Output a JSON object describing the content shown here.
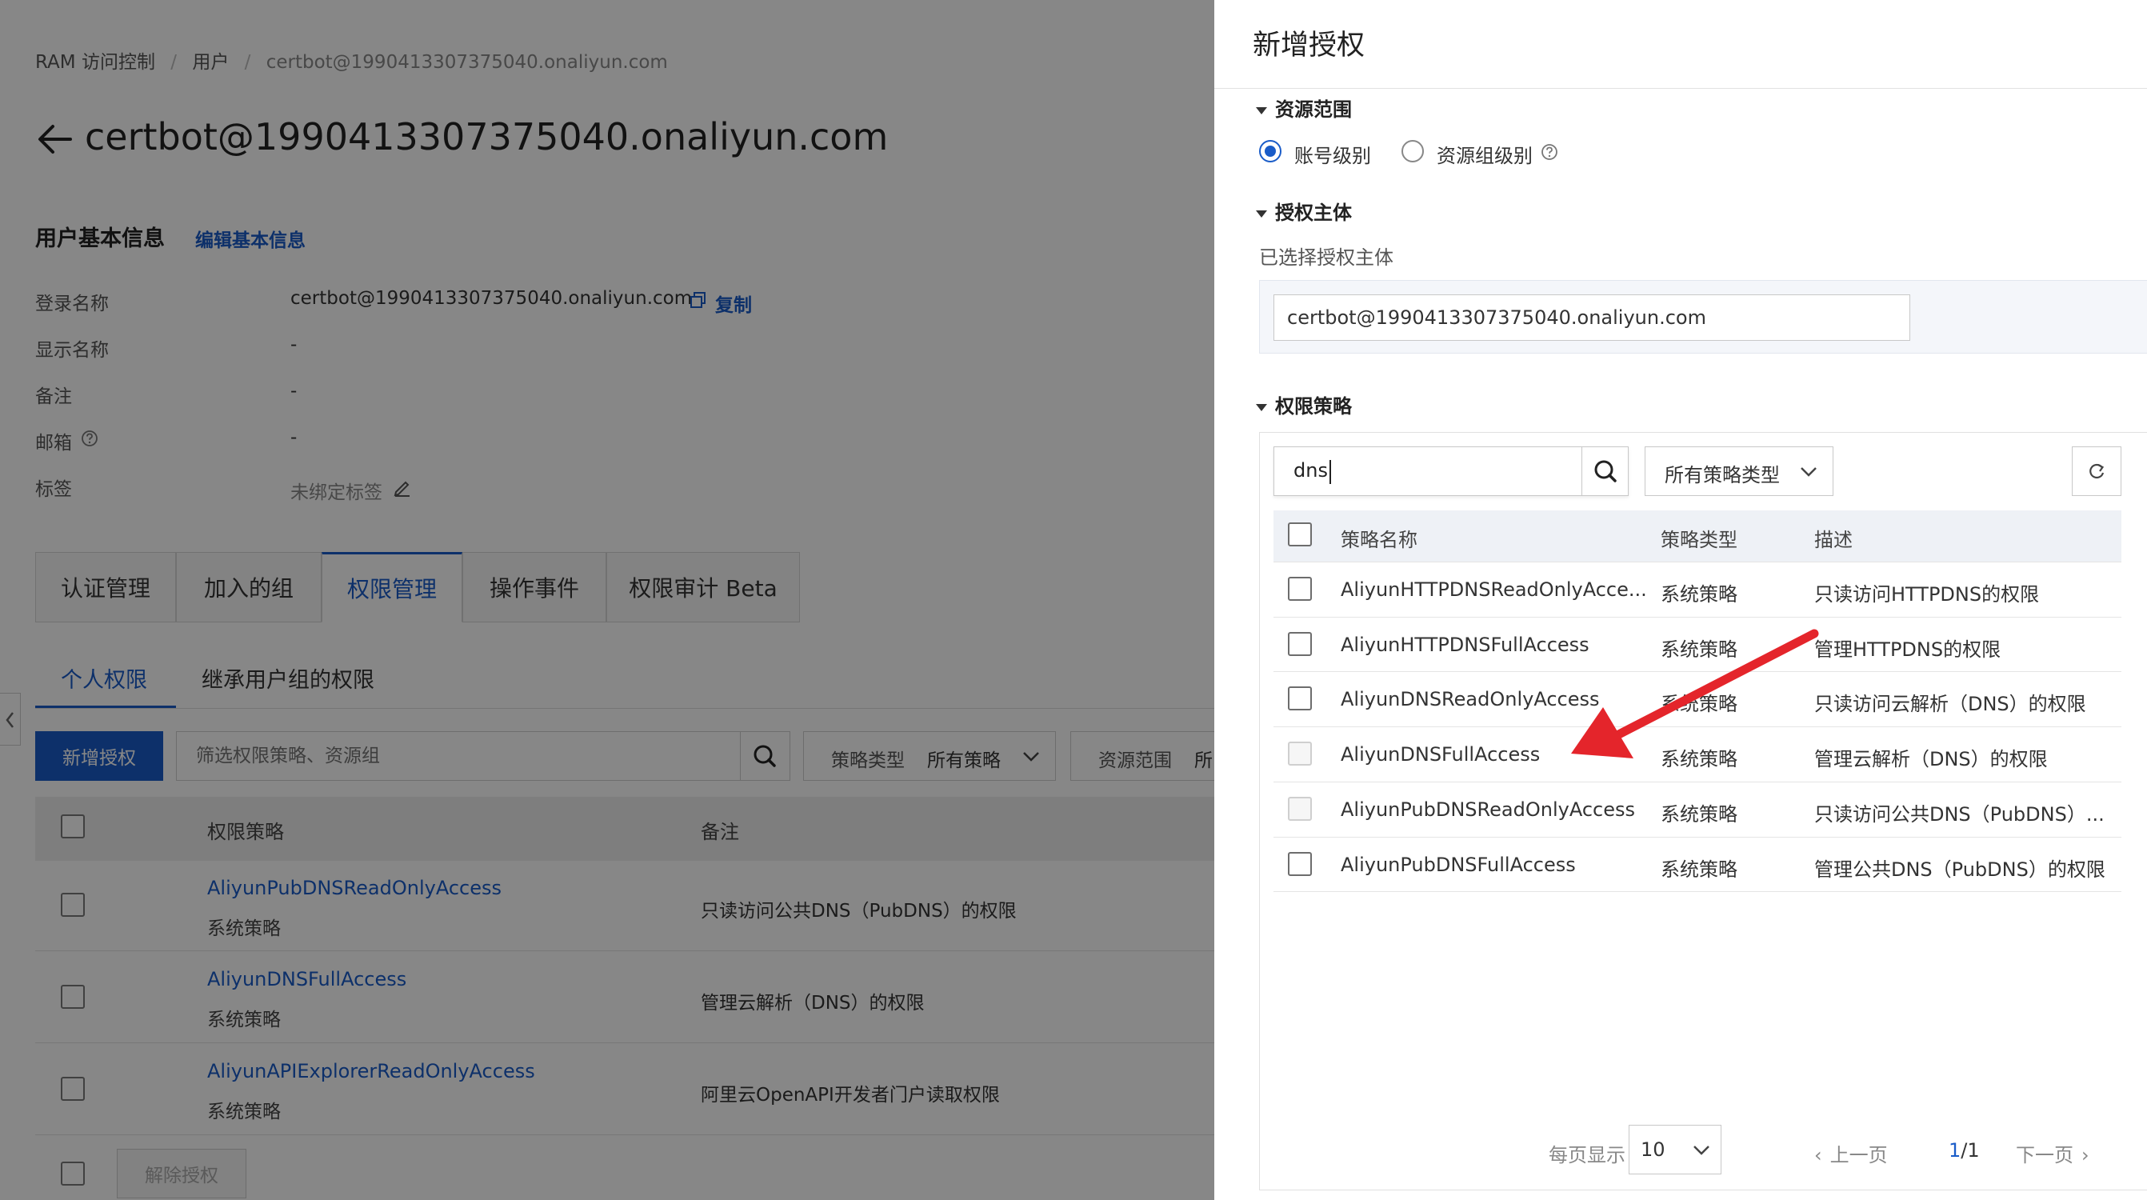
{
  "breadcrumb": {
    "root": "RAM 访问控制",
    "sep": "/",
    "users": "用户",
    "current": "certbot@1990413307375040.onaliyun.com"
  },
  "page": {
    "title": "certbot@1990413307375040.onaliyun.com"
  },
  "basic_info": {
    "title": "用户基本信息",
    "edit_link": "编辑基本信息",
    "fields": [
      {
        "label": "登录名称",
        "value": "certbot@1990413307375040.onaliyun.com"
      },
      {
        "label": "显示名称",
        "value": "-"
      },
      {
        "label": "备注",
        "value": "-"
      },
      {
        "label": "邮箱",
        "value": "-"
      },
      {
        "label": "标签",
        "value": "未绑定标签"
      }
    ],
    "copy_link": "复制"
  },
  "tabs": [
    "认证管理",
    "加入的组",
    "权限管理",
    "操作事件",
    "权限审计 Beta"
  ],
  "subtabs": [
    "个人权限",
    "继承用户组的权限"
  ],
  "toolbar": {
    "add_button": "新增授权",
    "filter_placeholder": "筛选权限策略、资源组",
    "policy_type_label": "策略类型",
    "policy_type_value": "所有策略",
    "scope_label": "资源范围",
    "scope_value": "所"
  },
  "perm_table": {
    "headers": [
      "权限策略",
      "备注"
    ],
    "rows": [
      {
        "name": "AliyunPubDNSReadOnlyAccess",
        "type": "系统策略",
        "note": "只读访问公共DNS（PubDNS）的权限"
      },
      {
        "name": "AliyunDNSFullAccess",
        "type": "系统策略",
        "note": "管理云解析（DNS）的权限"
      },
      {
        "name": "AliyunAPIExplorerReadOnlyAccess",
        "type": "系统策略",
        "note": "阿里云OpenAPI开发者门户读取权限"
      }
    ],
    "revoke_button": "解除授权"
  },
  "drawer": {
    "title": "新增授权",
    "scope_section": "资源范围",
    "scope_options": [
      "账号级别",
      "资源组级别"
    ],
    "principal_section": "授权主体",
    "principal_selected_label": "已选择授权主体",
    "principal_value": "certbot@1990413307375040.onaliyun.com",
    "policy_section": "权限策略",
    "search_value": "dns",
    "type_select": "所有策略类型",
    "table_headers": [
      "策略名称",
      "策略类型",
      "描述"
    ],
    "rows": [
      {
        "name": "AliyunHTTPDNSReadOnlyAcce...",
        "type": "系统策略",
        "desc": "只读访问HTTPDNS的权限"
      },
      {
        "name": "AliyunHTTPDNSFullAccess",
        "type": "系统策略",
        "desc": "管理HTTPDNS的权限"
      },
      {
        "name": "AliyunDNSReadOnlyAccess",
        "type": "系统策略",
        "desc": "只读访问云解析（DNS）的权限"
      },
      {
        "name": "AliyunDNSFullAccess",
        "type": "系统策略",
        "desc": "管理云解析（DNS）的权限"
      },
      {
        "name": "AliyunPubDNSReadOnlyAccess",
        "type": "系统策略",
        "desc": "只读访问公共DNS（PubDNS）..."
      },
      {
        "name": "AliyunPubDNSFullAccess",
        "type": "系统策略",
        "desc": "管理公共DNS（PubDNS）的权限"
      }
    ],
    "pagination": {
      "per_page_label": "每页显示",
      "per_page_value": "10",
      "prev": "上一页",
      "page_current": "1",
      "page_sep": "/",
      "page_total": "1",
      "next": "下一页"
    }
  },
  "colors": {
    "primary": "#1a5cc8",
    "arrow": "#e4252b",
    "overlay": "rgba(0,0,0,0.47)"
  }
}
